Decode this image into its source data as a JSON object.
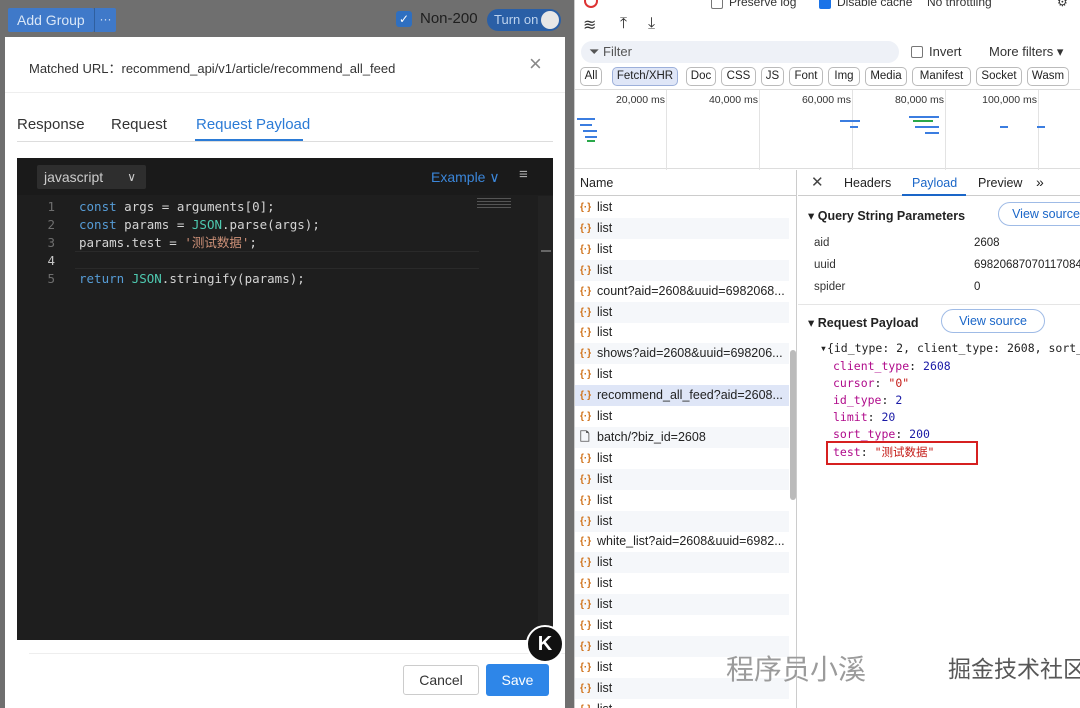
{
  "left_toolbar": {
    "add_group": "Add Group",
    "more": "···",
    "non200": "Non-200",
    "turn_on": "Turn on"
  },
  "modal": {
    "matched_url_label": "Matched URL：",
    "matched_url": "recommend_api/v1/article/recommend_all_feed",
    "close": "×",
    "tabs": [
      "Response",
      "Request",
      "Request Payload"
    ],
    "active_tab": "Request Payload",
    "editor": {
      "language": "javascript",
      "example": "Example",
      "lines": [
        {
          "n": "1",
          "code": "const args = arguments[0];"
        },
        {
          "n": "2",
          "code": "const params = JSON.parse(args);"
        },
        {
          "n": "3",
          "code": "params.test = '测试数据';"
        },
        {
          "n": "4",
          "code": ""
        },
        {
          "n": "5",
          "code": "return JSON.stringify(params);"
        }
      ]
    },
    "cancel": "Cancel",
    "save": "Save"
  },
  "devtools": {
    "toolbar": {
      "preserve_log": "Preserve log",
      "disable_cache": "Disable cache",
      "throttle": "No throttling"
    },
    "filter_placeholder": "Filter",
    "invert": "Invert",
    "more_filters": "More filters",
    "type_chips": [
      "All",
      "Fetch/XHR",
      "Doc",
      "CSS",
      "JS",
      "Font",
      "Img",
      "Media",
      "Manifest",
      "Socket",
      "Wasm"
    ],
    "active_chip": "Fetch/XHR",
    "timeline_ticks": [
      "20,000 ms",
      "40,000 ms",
      "60,000 ms",
      "80,000 ms",
      "100,000 ms"
    ],
    "name_header": "Name",
    "requests": [
      {
        "name": "list",
        "type": "xhr"
      },
      {
        "name": "list",
        "type": "xhr"
      },
      {
        "name": "list",
        "type": "xhr"
      },
      {
        "name": "list",
        "type": "xhr"
      },
      {
        "name": "count?aid=2608&uuid=6982068...",
        "type": "xhr"
      },
      {
        "name": "list",
        "type": "xhr"
      },
      {
        "name": "list",
        "type": "xhr"
      },
      {
        "name": "shows?aid=2608&uuid=698206...",
        "type": "xhr"
      },
      {
        "name": "list",
        "type": "xhr"
      },
      {
        "name": "recommend_all_feed?aid=2608...",
        "type": "xhr",
        "selected": true
      },
      {
        "name": "list",
        "type": "xhr"
      },
      {
        "name": "batch/?biz_id=2608",
        "type": "doc"
      },
      {
        "name": "list",
        "type": "xhr"
      },
      {
        "name": "list",
        "type": "xhr"
      },
      {
        "name": "list",
        "type": "xhr"
      },
      {
        "name": "list",
        "type": "xhr"
      },
      {
        "name": "white_list?aid=2608&uuid=6982...",
        "type": "xhr"
      },
      {
        "name": "list",
        "type": "xhr"
      },
      {
        "name": "list",
        "type": "xhr"
      },
      {
        "name": "list",
        "type": "xhr"
      },
      {
        "name": "list",
        "type": "xhr"
      },
      {
        "name": "list",
        "type": "xhr"
      },
      {
        "name": "list",
        "type": "xhr"
      },
      {
        "name": "list",
        "type": "xhr"
      },
      {
        "name": "list",
        "type": "xhr"
      }
    ],
    "detail_tabs": [
      "Headers",
      "Payload",
      "Preview"
    ],
    "active_detail_tab": "Payload",
    "query_section": "Query String Parameters",
    "view_source": "View source",
    "query_params": [
      {
        "key": "aid",
        "value": "2608"
      },
      {
        "key": "uuid",
        "value": "69820687070117084"
      },
      {
        "key": "spider",
        "value": "0"
      }
    ],
    "payload_section": "Request Payload",
    "payload_summary": "{id_type: 2, client_type: 2608, sort_t",
    "payload_fields": [
      {
        "key": "client_type",
        "value": "2608",
        "kind": "num"
      },
      {
        "key": "cursor",
        "value": "\"0\"",
        "kind": "str"
      },
      {
        "key": "id_type",
        "value": "2",
        "kind": "num"
      },
      {
        "key": "limit",
        "value": "20",
        "kind": "num"
      },
      {
        "key": "sort_type",
        "value": "200",
        "kind": "num"
      },
      {
        "key": "test",
        "value": "\"测试数据\"",
        "kind": "str"
      }
    ]
  },
  "watermark": "掘金技术社区 @ 小溪彼岸",
  "watermark_faded": "程序员小溪",
  "colors": {
    "accent": "#2b7bd6",
    "save": "#2e86e8",
    "highlight_box": "#d62020"
  }
}
